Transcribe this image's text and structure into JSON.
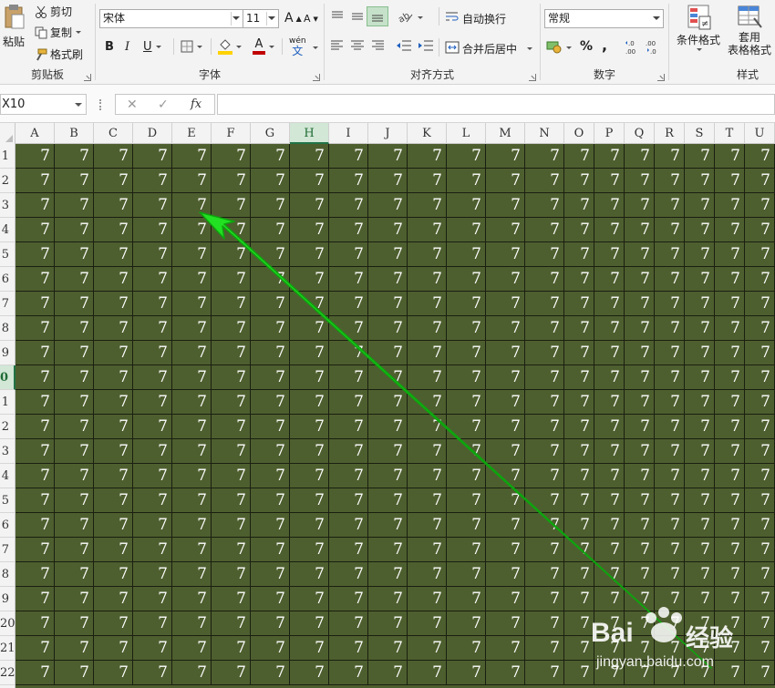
{
  "ribbon": {
    "clipboard": {
      "paste": "粘贴",
      "cut": "剪切",
      "copy": "复制",
      "format_painter": "格式刷",
      "label": "剪贴板"
    },
    "font": {
      "family": "宋体",
      "size": "11",
      "label": "字体",
      "bold": "B",
      "italic": "I",
      "underline": "U",
      "grow": "A",
      "shrink": "A",
      "wen": "wén",
      "wen2": "文",
      "font_color_letter": "A",
      "font_color": "#c00000",
      "fill_color": "#ffd200"
    },
    "alignment": {
      "wrap_text": "自动换行",
      "merge_center": "合并后居中",
      "label": "对齐方式"
    },
    "number": {
      "format": "常规",
      "label": "数字",
      "percent": "%",
      "comma": ",",
      "inc_decimal": "←.0 .00",
      "dec_decimal": ".00 →.0"
    },
    "styles": {
      "conditional": "条件格式",
      "table_format_1": "套用",
      "table_format_2": "表格格式",
      "label": "样式"
    }
  },
  "formula_bar": {
    "name_box": "X10",
    "cancel_glyph": "✕",
    "enter_glyph": "✓",
    "fx_glyph": "fx",
    "formula": ""
  },
  "sheet": {
    "columns": [
      "A",
      "B",
      "C",
      "D",
      "E",
      "F",
      "G",
      "H",
      "I",
      "J",
      "K",
      "L",
      "M",
      "N",
      "O",
      "P",
      "Q",
      "R",
      "S",
      "T",
      "U"
    ],
    "row_labels": [
      "1",
      "2",
      "3",
      "4",
      "5",
      "6",
      "7",
      "8",
      "9",
      "0",
      "1",
      "2",
      "3",
      "4",
      "5",
      "6",
      "7",
      "8",
      "9",
      "20",
      "21",
      "22"
    ],
    "selected_column": "H",
    "selected_row_index": 9,
    "cell_value": "7",
    "cell_fill": "#4e5f2f",
    "cell_text_color": "#ffffff",
    "arrow_color": "#22e022"
  },
  "watermark": {
    "brand": "Bai",
    "brand2": "经验",
    "url": "jingyan.baidu.com"
  }
}
